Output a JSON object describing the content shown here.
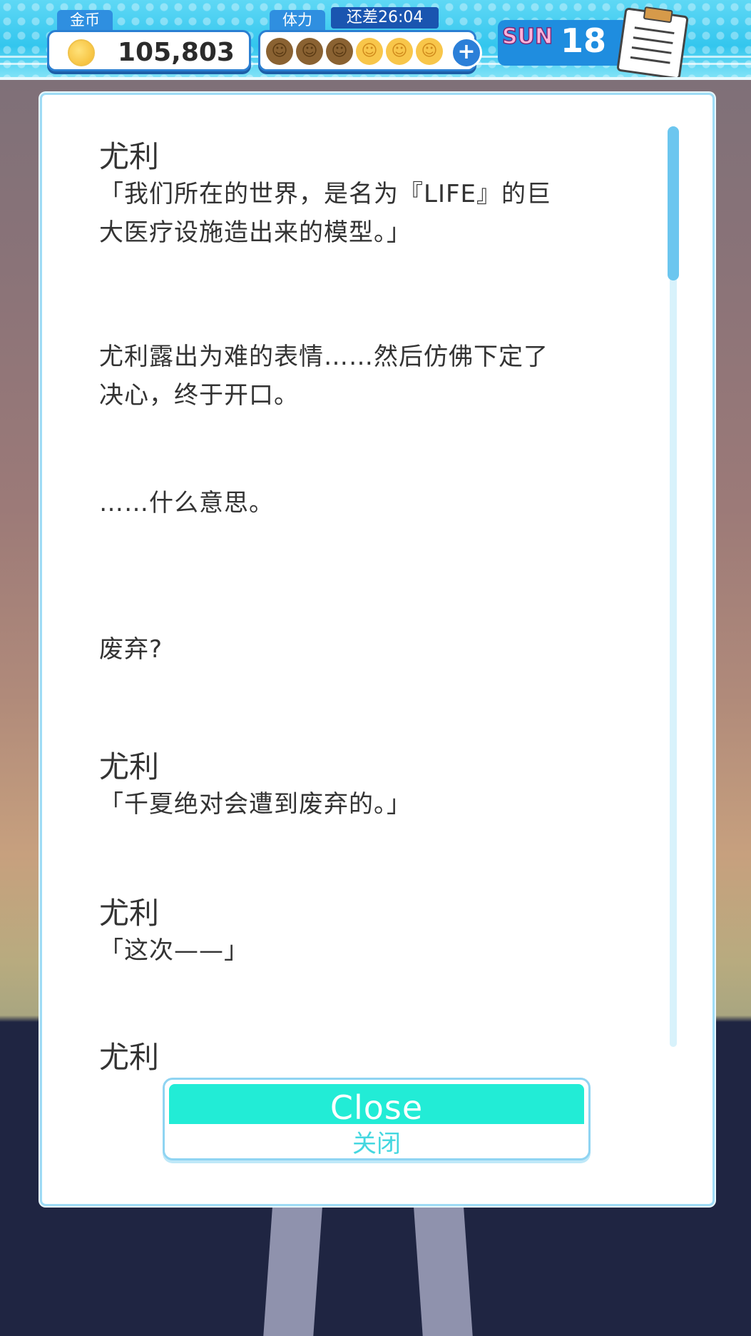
{
  "status_bar": {
    "coin_label": "金币",
    "coin_value": "105,803",
    "stamina_label": "体力",
    "stamina_timer": "还差26:04",
    "stamina_used": 3,
    "stamina_total": 6,
    "weekday": "SUN",
    "day": "18",
    "add_icon": "plus-icon",
    "memo_icon": "notepad-icon"
  },
  "log": {
    "entries": [
      {
        "speaker": "尤利",
        "lines": [
          "「我们所在的世界，是名为『LIFE』的巨",
          "大医疗设施造出来的模型。」"
        ]
      },
      {
        "speaker": "",
        "lines": [
          "尤利露出为难的表情……然后仿佛下定了",
          "决心，终于开口。"
        ]
      },
      {
        "speaker": "",
        "lines": [
          "……什么意思。"
        ]
      },
      {
        "speaker": "",
        "lines": [
          "废弃?"
        ]
      },
      {
        "speaker": "尤利",
        "lines": [
          "「千夏绝对会遭到废弃的。」"
        ]
      },
      {
        "speaker": "尤利",
        "lines": [
          "「这次——」"
        ]
      },
      {
        "speaker": "尤利",
        "lines": []
      }
    ]
  },
  "close_button": {
    "label_en": "Close",
    "label_zh": "关闭"
  },
  "colors": {
    "accent": "#22ecd6",
    "topbar": "#33c6ee",
    "scroll_thumb": "#6cc6ef"
  }
}
